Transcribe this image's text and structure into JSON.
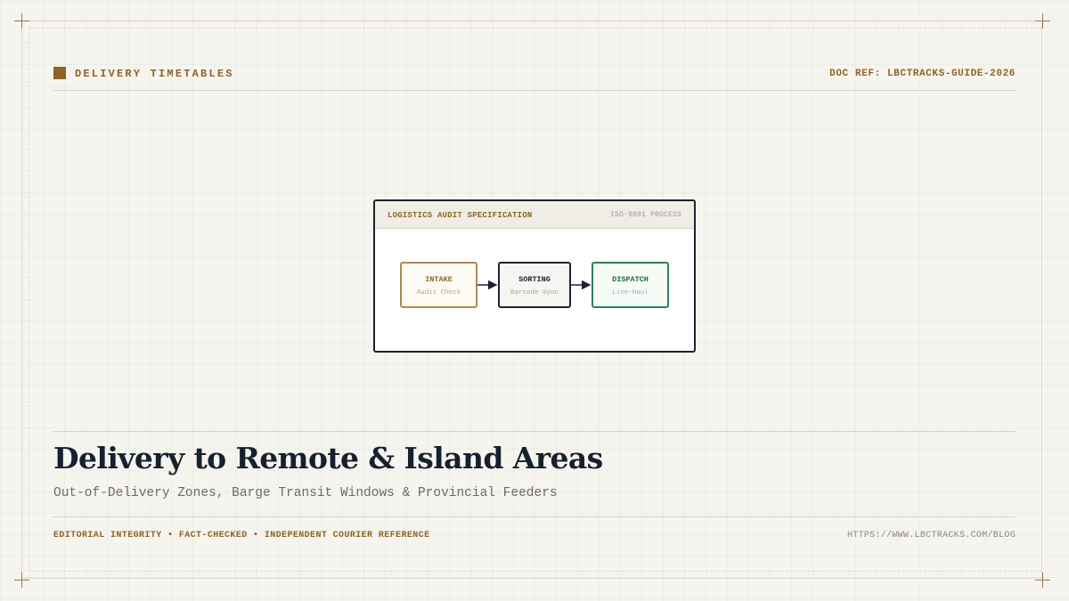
{
  "header": {
    "section_label": "DELIVERY TIMETABLES",
    "doc_ref": "DOC REF: LBCTRACKS-GUIDE-2026"
  },
  "diagram": {
    "title": "LOGISTICS AUDIT SPECIFICATION",
    "tag": "ISO-9001 PROCESS",
    "nodes": [
      {
        "title": "INTAKE",
        "subtitle": "Audit Check",
        "color": "#8c6424"
      },
      {
        "title": "SORTING",
        "subtitle": "Barcode Sync",
        "color": "#1c2330"
      },
      {
        "title": "DISPATCH",
        "subtitle": "Line-Haul",
        "color": "#1e6b44"
      }
    ]
  },
  "article": {
    "title": "Delivery to Remote & Island Areas",
    "subtitle": "Out-of-Delivery Zones, Barge Transit Windows & Provincial Feeders"
  },
  "footer": {
    "tagline": "EDITORIAL INTEGRITY • FACT-CHECKED • INDEPENDENT COURIER REFERENCE",
    "url": "HTTPS://WWW.LBCTRACKS.COM/BLOG"
  },
  "colors": {
    "accent": "#8c6424",
    "ink": "#16202e",
    "background": "#f6f4ef",
    "success": "#2f8055"
  }
}
